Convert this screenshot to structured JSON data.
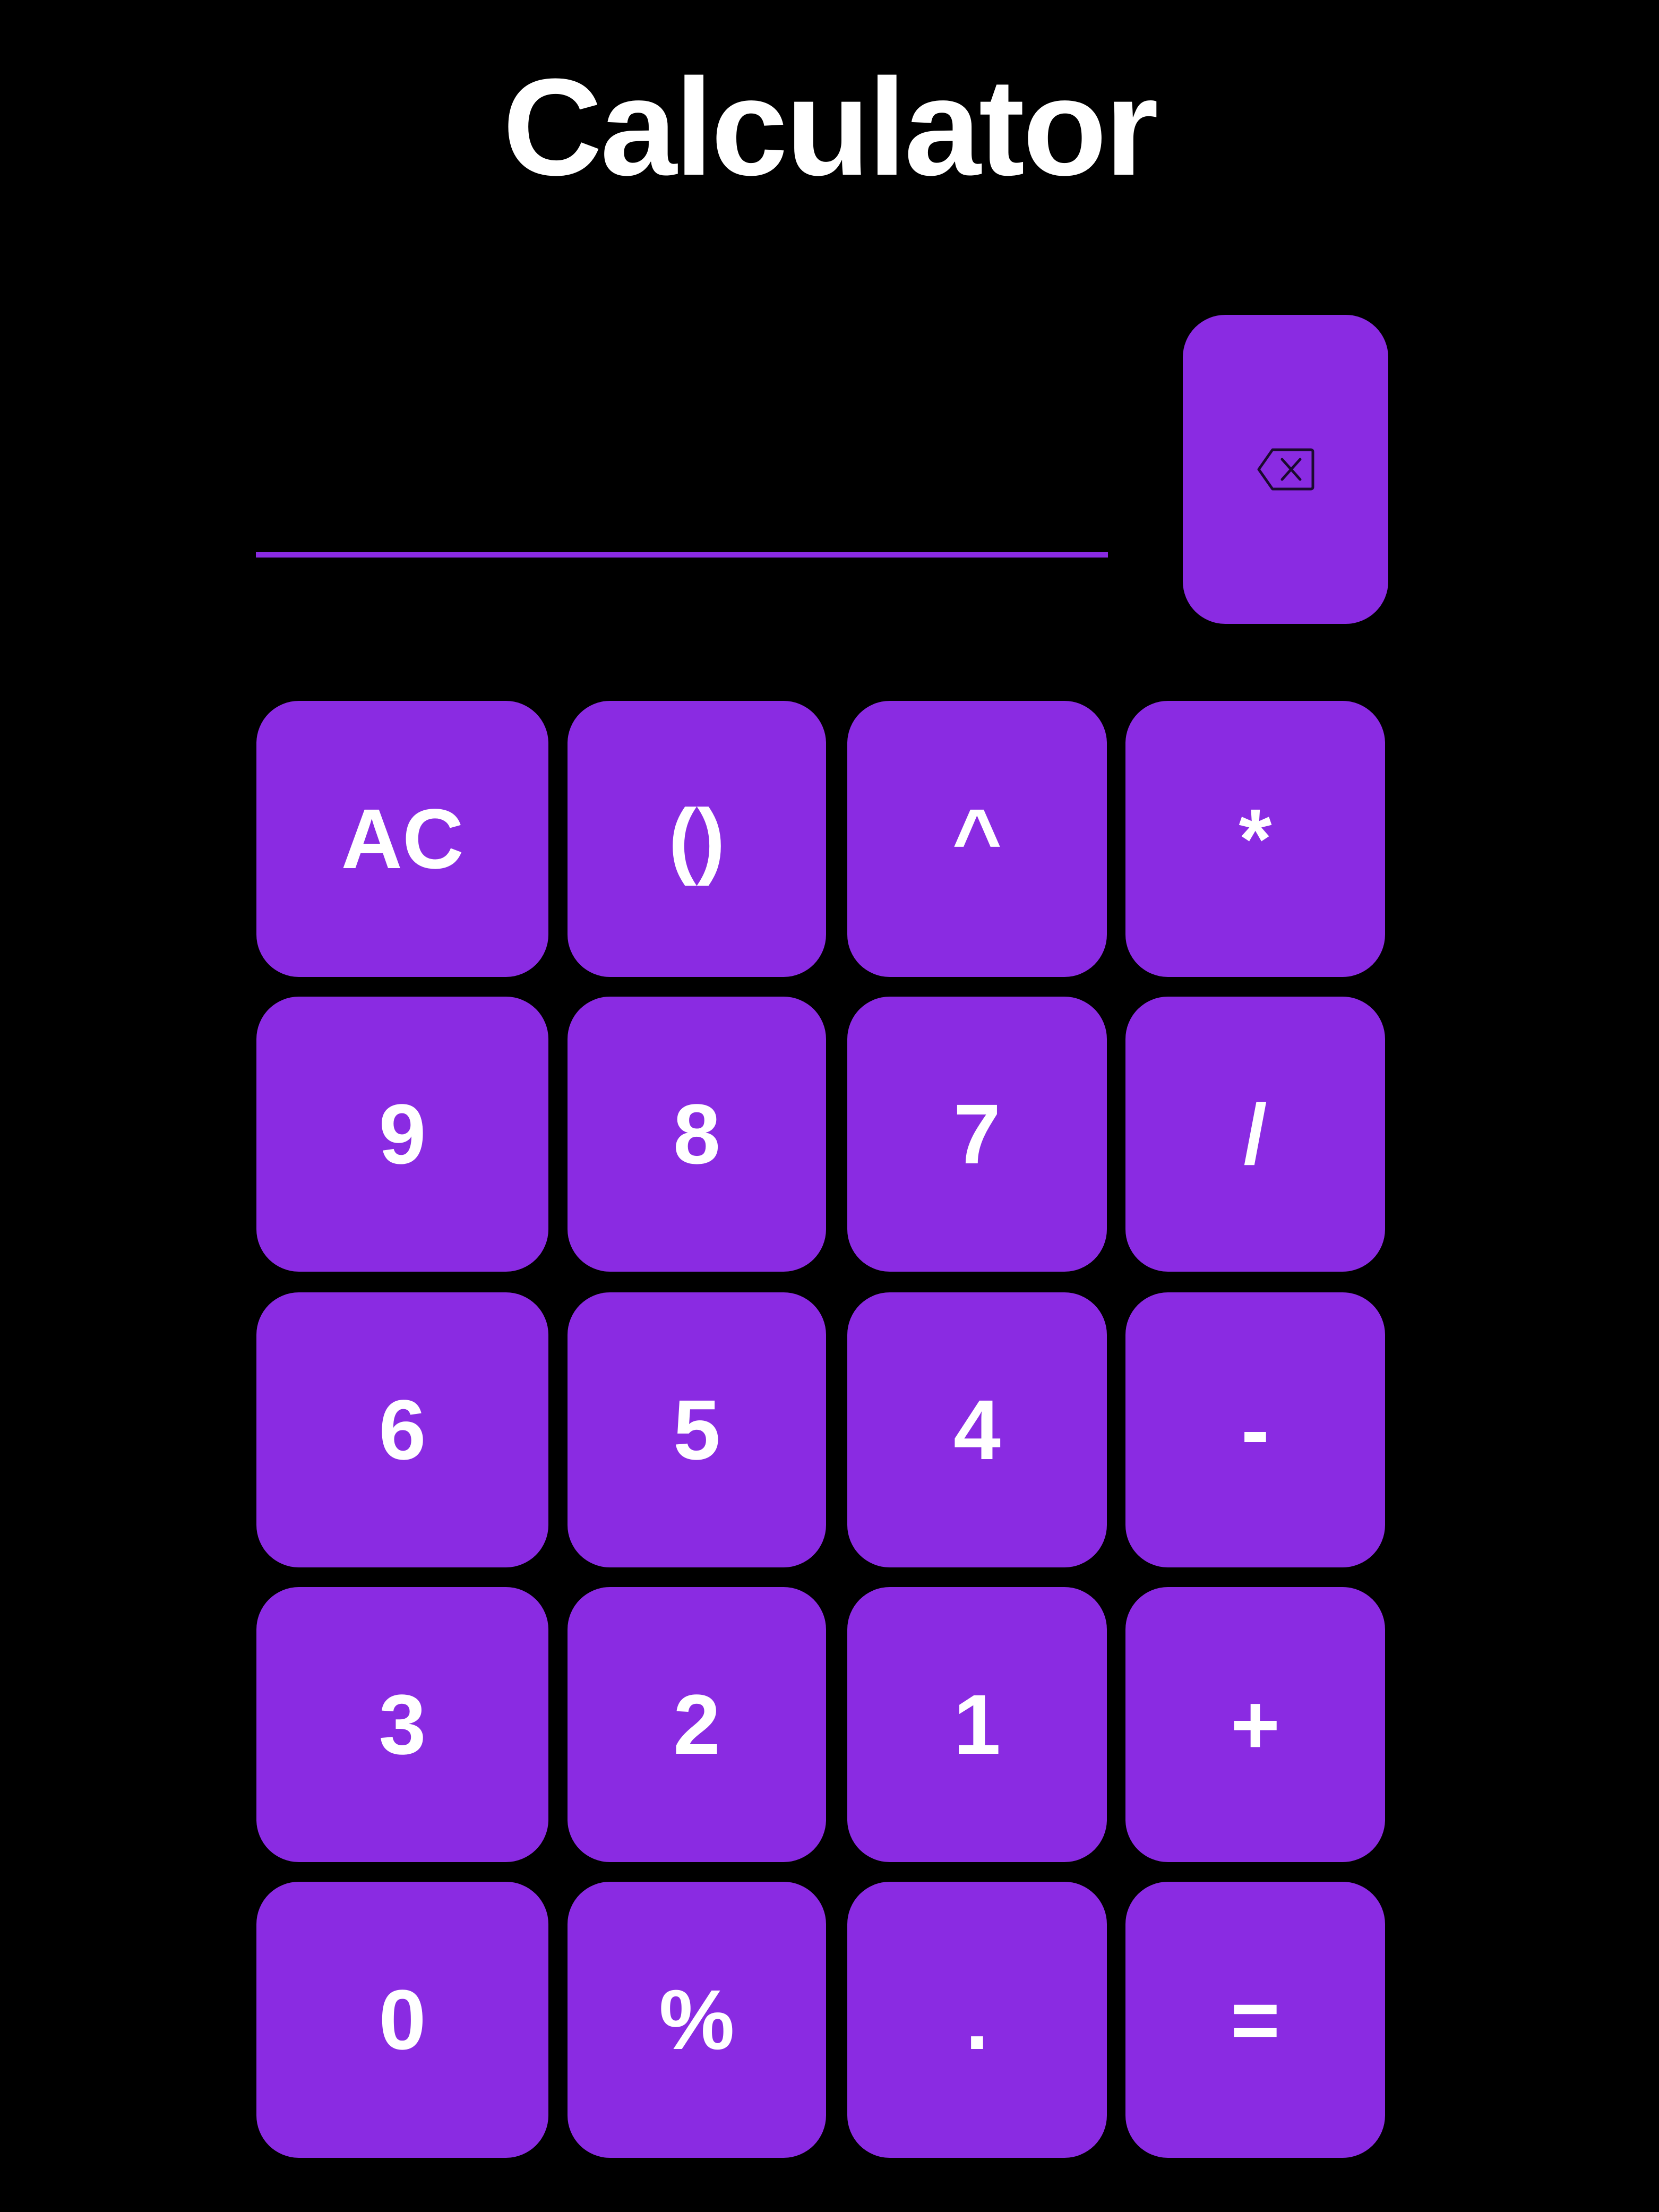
{
  "app": {
    "title": "Calculator"
  },
  "display": {
    "value": "",
    "placeholder": "",
    "backspace_icon": "backspace-icon"
  },
  "colors": {
    "background": "#000000",
    "accent": "#8a2be2",
    "text": "#ffffff"
  },
  "keypad": {
    "r1": [
      "AC",
      "()",
      "^",
      "*"
    ],
    "r2": [
      "9",
      "8",
      "7",
      "/"
    ],
    "r3": [
      "6",
      "5",
      "4",
      "-"
    ],
    "r4": [
      "3",
      "2",
      "1",
      "+"
    ],
    "r5": [
      "0",
      "%",
      ".",
      "="
    ]
  }
}
